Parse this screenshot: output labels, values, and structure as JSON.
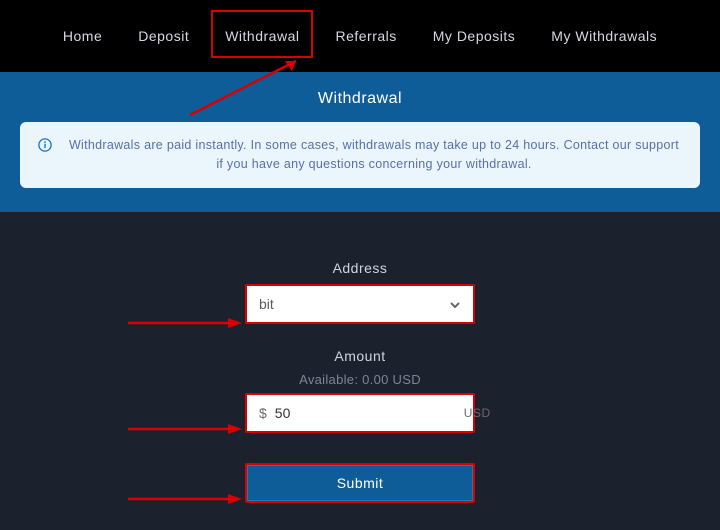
{
  "nav": {
    "items": [
      "Home",
      "Deposit",
      "Withdrawal",
      "Referrals",
      "My Deposits",
      "My Withdrawals"
    ]
  },
  "banner": {
    "title": "Withdrawal",
    "notice": "Withdrawals are paid instantly. In some cases, withdrawals may take up to 24 hours. Contact our support if you have any questions concerning your withdrawal."
  },
  "form": {
    "address_label": "Address",
    "address_value": "bit",
    "amount_label": "Amount",
    "available_text": "Available: 0.00 USD",
    "amount_prefix": "$",
    "amount_value": "50",
    "amount_suffix": "USD",
    "submit_label": "Submit"
  },
  "annotations": {
    "highlight_color": "#d80000"
  }
}
